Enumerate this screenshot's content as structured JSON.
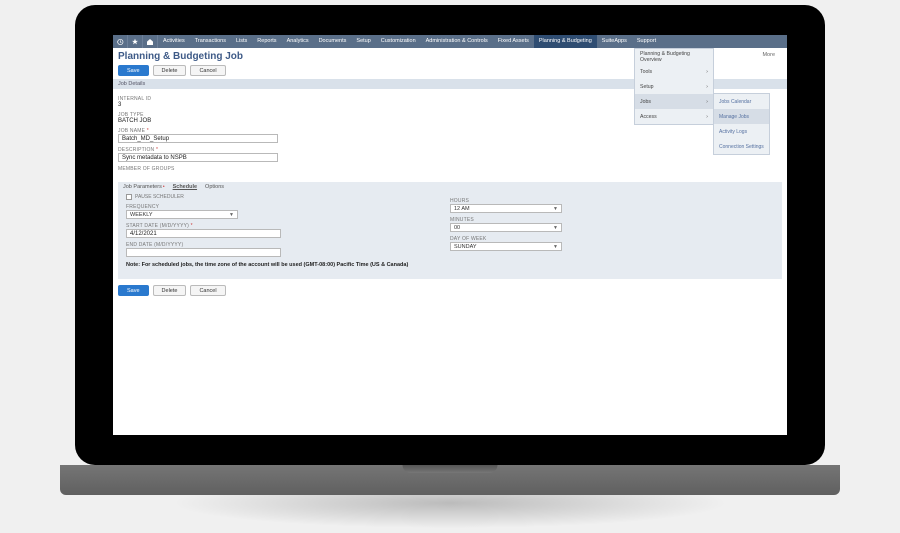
{
  "topbar": {
    "nav": [
      "Activities",
      "Transactions",
      "Lists",
      "Reports",
      "Analytics",
      "Documents",
      "Setup",
      "Customization",
      "Administration & Controls",
      "Fixed Assets",
      "Planning & Budgeting",
      "SuiteApps",
      "Support"
    ],
    "active": "Planning & Budgeting"
  },
  "dropdown1": [
    {
      "label": "Planning & Budgeting Overview",
      "arrow": false,
      "hov": false
    },
    {
      "label": "Tools",
      "arrow": true,
      "hov": false
    },
    {
      "label": "Setup",
      "arrow": true,
      "hov": false
    },
    {
      "label": "Jobs",
      "arrow": true,
      "hov": true
    },
    {
      "label": "Access",
      "arrow": true,
      "hov": false
    }
  ],
  "dropdown2": [
    {
      "label": "Jobs Calendar",
      "hov": false
    },
    {
      "label": "Manage Jobs",
      "hov": true
    },
    {
      "label": "Activity Logs",
      "hov": false
    },
    {
      "label": "Connection Settings",
      "hov": false
    }
  ],
  "page": {
    "title": "Planning & Budgeting Job",
    "more": "More",
    "save": "Save",
    "delete": "Delete",
    "cancel": "Cancel"
  },
  "section_job_details": "Job Details",
  "fields": {
    "internal_id_lbl": "INTERNAL ID",
    "internal_id_val": "3",
    "job_type_lbl": "JOB TYPE",
    "job_type_val": "BATCH JOB",
    "job_name_lbl": "JOB NAME",
    "job_name_val": "Batch_MD_Setup",
    "description_lbl": "DESCRIPTION",
    "description_val": "Sync metadata to NSPB",
    "member_lbl": "MEMBER OF GROUPS"
  },
  "tabs": {
    "job_parameters": "Job Parameters",
    "schedule": "Schedule",
    "options": "Options"
  },
  "schedule": {
    "pause_lbl": "PAUSE SCHEDULER",
    "frequency_lbl": "FREQUENCY",
    "frequency_val": "WEEKLY",
    "start_lbl": "START DATE (M/D/YYYY)",
    "start_val": "4/12/2021",
    "end_lbl": "END DATE (M/D/YYYY)",
    "hours_lbl": "HOURS",
    "hours_val": "12 AM",
    "minutes_lbl": "MINUTES",
    "minutes_val": "00",
    "dow_lbl": "DAY OF WEEK",
    "dow_val": "SUNDAY",
    "note": "Note: For scheduled jobs, the time zone of the account will be used (GMT-08:00) Pacific Time (US & Canada)"
  }
}
